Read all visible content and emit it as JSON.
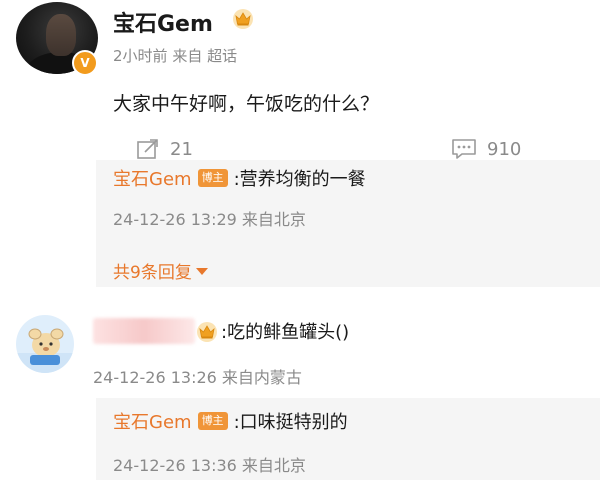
{
  "post": {
    "author": "宝石Gem",
    "time": "2小时前",
    "source": "来自 超话",
    "content": "大家中午好啊，午饭吃的什么？"
  },
  "actions": {
    "repost_count": "21",
    "comment_count": "910"
  },
  "replies": [
    {
      "author": "宝石Gem",
      "badge": "博主",
      "text": ":营养均衡的一餐",
      "meta": "24-12-26 13:29 来自北京",
      "expand_label": "共9条回复"
    }
  ],
  "comments": [
    {
      "text": ":吃的鲱鱼罐头()",
      "meta": "24-12-26 13:26 来自内蒙古",
      "reply": {
        "author": "宝石Gem",
        "badge": "博主",
        "text": ":口味挺特别的",
        "meta": "24-12-26 13:36 来自北京"
      }
    }
  ],
  "colors": {
    "accent_orange": "#e8782c",
    "badge_orange": "#f09538",
    "muted_gray": "#8a8a8a",
    "reply_bg": "#f5f5f5"
  },
  "icons": {
    "vip": "vip-icon",
    "crown": "crown-icon",
    "repost": "repost-icon",
    "comment": "comment-icon"
  }
}
